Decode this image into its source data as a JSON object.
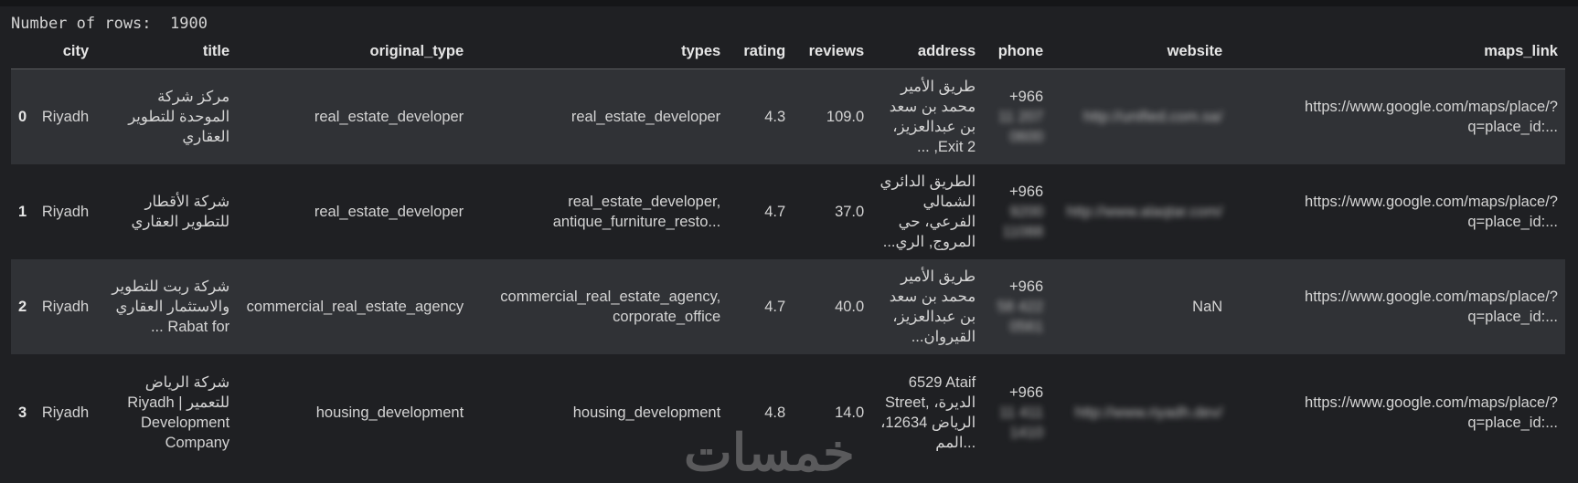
{
  "output": {
    "rows_label": "Number of rows:",
    "rows_value": "1900"
  },
  "table": {
    "columns": [
      "city",
      "title",
      "original_type",
      "types",
      "rating",
      "reviews",
      "address",
      "phone",
      "website",
      "maps_link"
    ],
    "rows": [
      {
        "index": "0",
        "city": "Riyadh",
        "title": "مركز شركة الموحدة للتطوير العقاري",
        "original_type": "real_estate_developer",
        "types": "real_estate_developer",
        "rating": "4.3",
        "reviews": "109.0",
        "address": "طريق الأمير محمد بن سعد بن عبدالعزيز، Exit 2, ...",
        "phone_prefix": "+966",
        "phone_rest": "11 207 0600",
        "website": "http://unified.com.sa/",
        "maps_link": "https://www.google.com/maps/place/?q=place_id:..."
      },
      {
        "index": "1",
        "city": "Riyadh",
        "title": "شركة الأقطار للتطوير العقاري",
        "original_type": "real_estate_developer",
        "types": "real_estate_developer, antique_furniture_resto...",
        "rating": "4.7",
        "reviews": "37.0",
        "address": "الطريق الدائري الشمالي الفرعي، حي المروج, الري...",
        "phone_prefix": "+966",
        "phone_rest": "9200 11088",
        "website": "http://www.alaqtar.com/",
        "maps_link": "https://www.google.com/maps/place/?q=place_id:..."
      },
      {
        "index": "2",
        "city": "Riyadh",
        "title": "شركة ربت للتطوير والاستثمار العقاري Rabat for ...",
        "original_type": "commercial_real_estate_agency",
        "types": "commercial_real_estate_agency, corporate_office",
        "rating": "4.7",
        "reviews": "40.0",
        "address": "طريق الأمير محمد بن سعد بن عبدالعزيز، القيروان...",
        "phone_prefix": "+966",
        "phone_rest": "58 422 0561",
        "website": "NaN",
        "maps_link": "https://www.google.com/maps/place/?q=place_id:..."
      },
      {
        "index": "3",
        "city": "Riyadh",
        "title": "شركة الرياض للتعمير | Riyadh Development Company",
        "original_type": "housing_development",
        "types": "housing_development",
        "rating": "4.8",
        "reviews": "14.0",
        "address": "6529 Ataif Street, الديرة، الرياض 12634، المم...",
        "phone_prefix": "+966",
        "phone_rest": "11 411 1410",
        "website": "http://www.riyadh.dev/",
        "maps_link": "https://www.google.com/maps/place/?q=place_id:..."
      }
    ]
  },
  "watermark": {
    "text": "خمسات"
  }
}
